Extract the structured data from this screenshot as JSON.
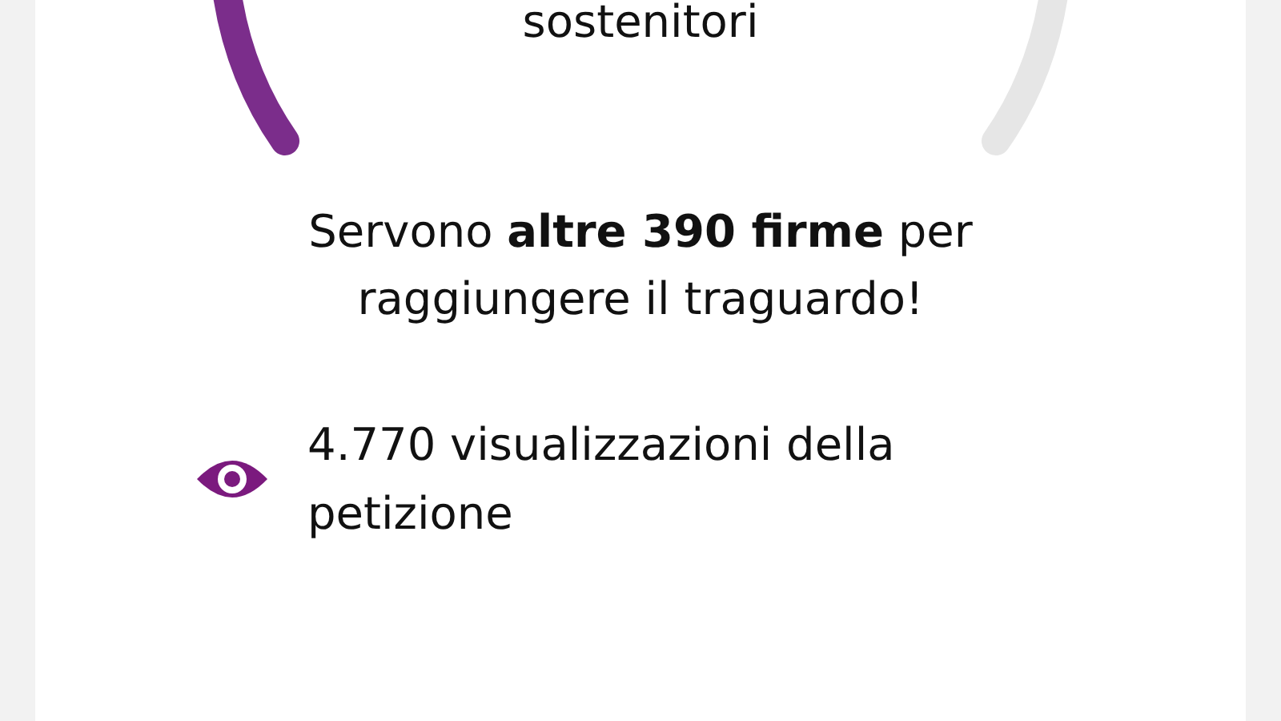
{
  "progress": {
    "caption": "sostenitori"
  },
  "message": "Servono **altre 390 firme** per raggiungere il traguardo!",
  "views": {
    "text": "4.770 visualizzazioni della petizione"
  }
}
